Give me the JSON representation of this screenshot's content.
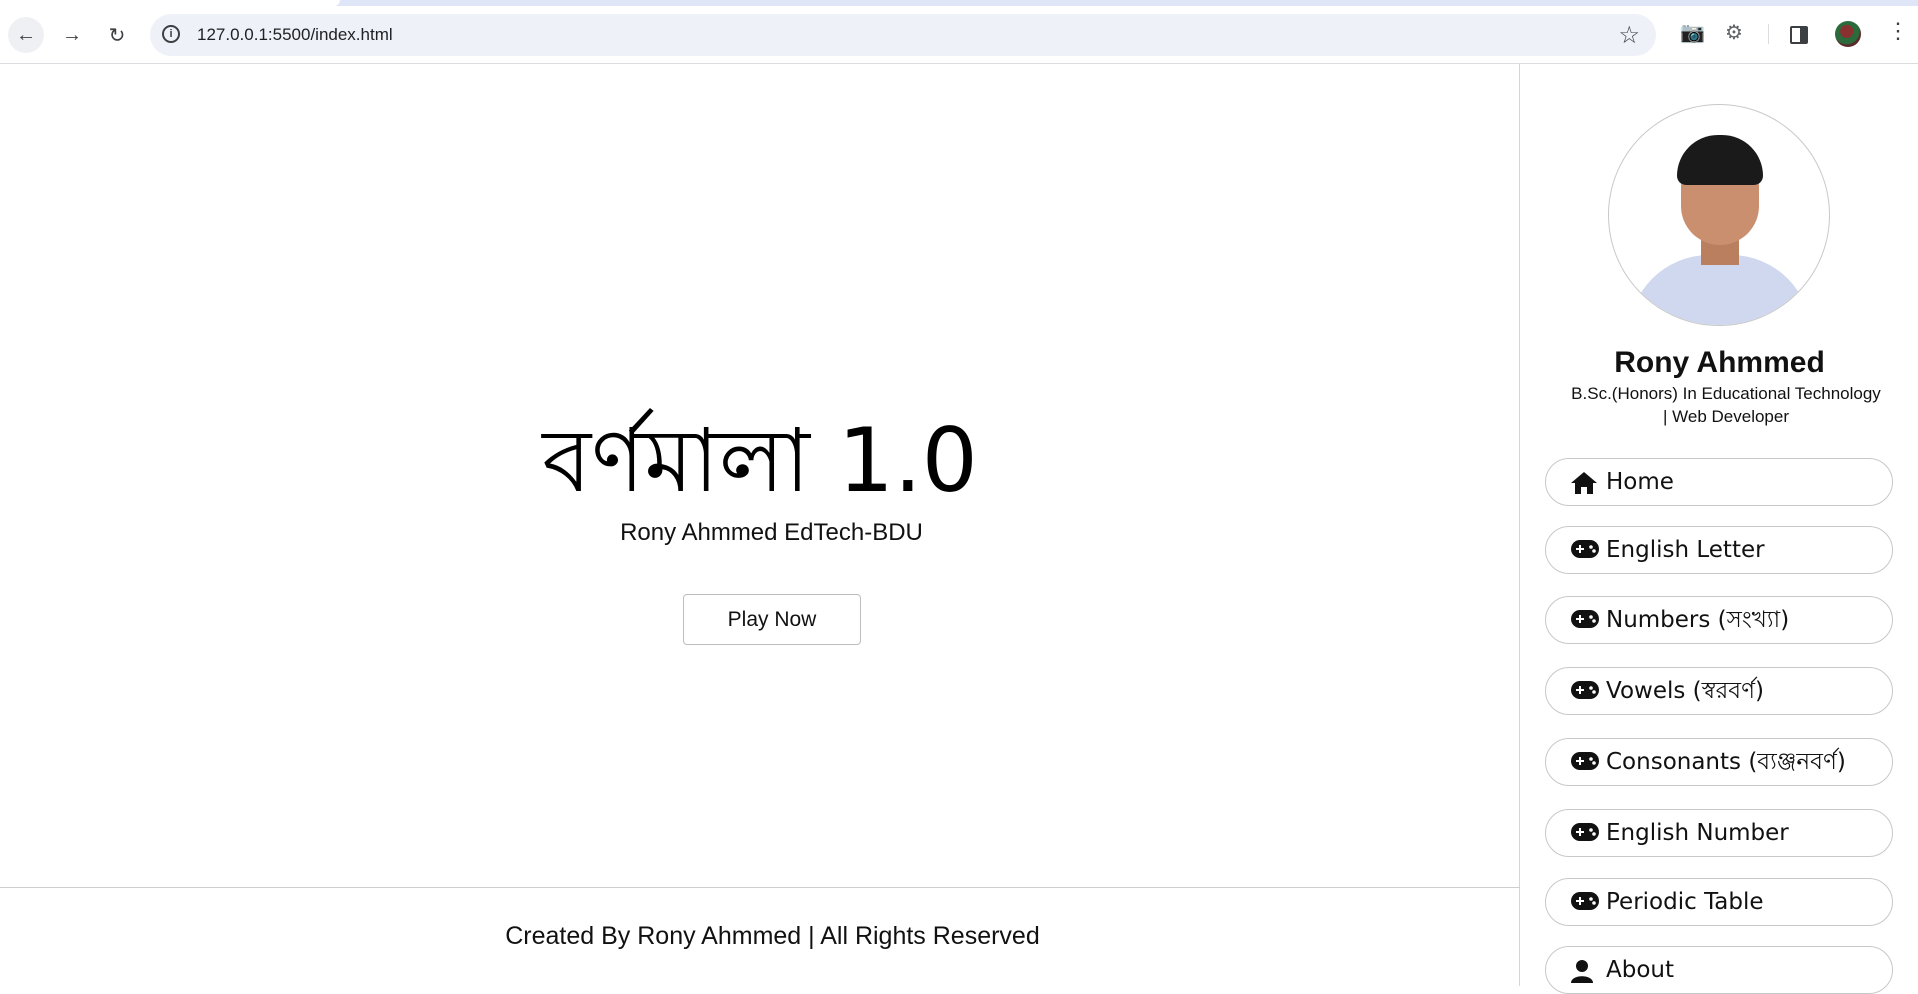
{
  "browser": {
    "url": "127.0.0.1:5500/index.html",
    "icons": [
      "back-arrow-icon",
      "forward-arrow-icon",
      "reload-icon",
      "site-info-icon",
      "bookmark-star-icon",
      "camera-icon",
      "extensions-icon",
      "side-panel-icon",
      "profile-avatar-icon",
      "more-menu-icon"
    ]
  },
  "hero": {
    "title": "বর্ণমালা 1.0",
    "subtitle": "Rony Ahmmed EdTech-BDU",
    "play_label": "Play Now"
  },
  "footer": {
    "credit": "Created By Rony Ahmmed | All Rights Reserved"
  },
  "profile": {
    "name": "Rony Ahmmed",
    "description_line1": "B.Sc.(Honors) In Educational Technology",
    "description_line2": "| Web Developer"
  },
  "nav": {
    "items": [
      {
        "label": "Home",
        "icon": "home-icon"
      },
      {
        "label": "English Letter",
        "icon": "gamepad-icon"
      },
      {
        "label": "Numbers (সংখ্যা)",
        "icon": "gamepad-icon"
      },
      {
        "label": "Vowels (স্বরবর্ণ)",
        "icon": "gamepad-icon"
      },
      {
        "label": "Consonants (ব্যঞ্জনবর্ণ)",
        "icon": "gamepad-icon"
      },
      {
        "label": "English Number",
        "icon": "gamepad-icon"
      },
      {
        "label": "Periodic Table",
        "icon": "gamepad-icon"
      },
      {
        "label": "About",
        "icon": "user-icon"
      }
    ]
  },
  "colors": {
    "border": "#c8c8c8",
    "text": "#111111",
    "omnibox": "#eef1f8"
  }
}
